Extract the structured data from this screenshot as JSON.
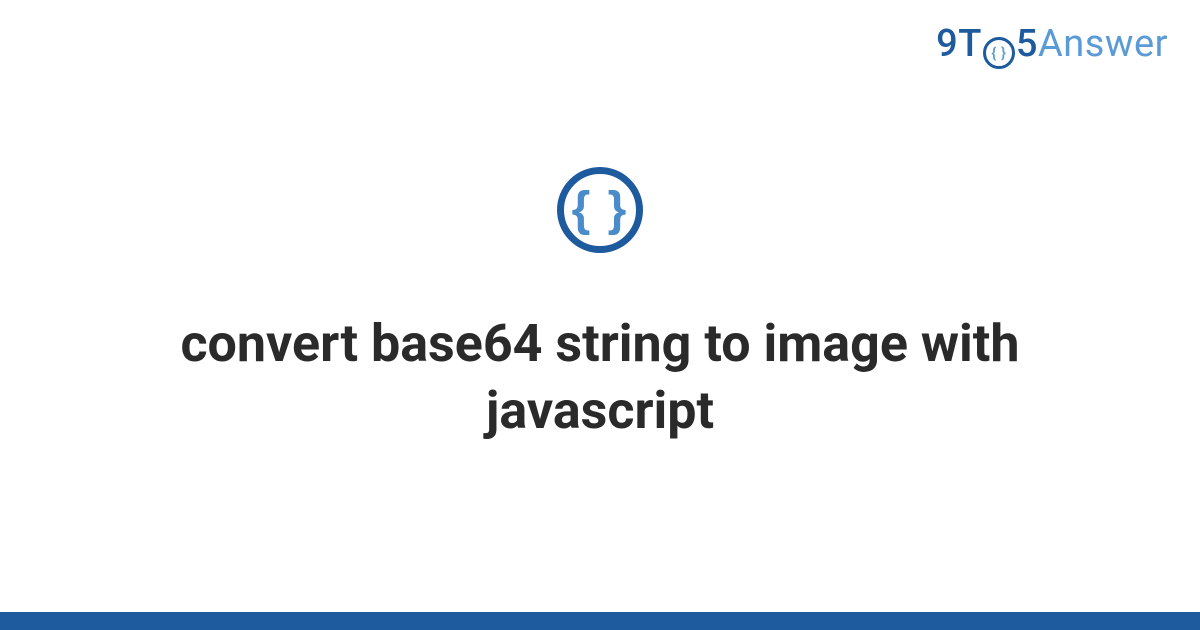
{
  "brand": {
    "part1": "9T",
    "circle_inner": "{ }",
    "part2": "5",
    "part3": "Answer"
  },
  "icon": {
    "braces": "{ }"
  },
  "title": "convert base64 string to image with javascript",
  "colors": {
    "primary": "#1e5a9e",
    "accent": "#5b9bd5",
    "text": "#2a2a2a"
  }
}
